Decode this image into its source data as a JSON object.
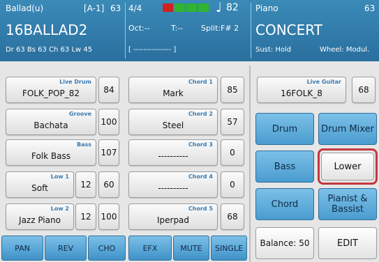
{
  "header": {
    "style": {
      "name": "Ballad(u)",
      "slot": "[A-1]",
      "value": "63",
      "big": "16BALLAD2",
      "info": "Dr 63   Bs 63   Ch 63   Lw 45"
    },
    "center": {
      "time_sig": "4/4",
      "tempo": "82",
      "tempo_icon": "quarter-note-icon",
      "oct": "Oct:--",
      "t": "T:--",
      "split": "Split:F# 2",
      "bar": "[ --------------- ]"
    },
    "voice": {
      "name": "Piano",
      "value": "63",
      "big": "CONCERT",
      "sust": "Sust: Hold",
      "wheel": "Wheel: Modul."
    },
    "colors": {
      "beat_lights": [
        "#d02020",
        "#2fb52f",
        "#2fb52f",
        "#2fb52f"
      ]
    }
  },
  "left_pads": [
    {
      "tag": "Live Drum",
      "label": "FOLK_POP_82",
      "value": "84"
    },
    {
      "tag": "Groove",
      "label": "Bachata",
      "value": "100"
    },
    {
      "tag": "Bass",
      "label": "Folk Bass",
      "value": "107"
    },
    {
      "tag": "Low 1",
      "label": "Soft",
      "aux": "12",
      "value": "60"
    },
    {
      "tag": "Low 2",
      "label": "Jazz Piano",
      "aux": "12",
      "value": "100"
    }
  ],
  "chord_pads": [
    {
      "tag": "Chord 1",
      "label": "Mark",
      "value": "85"
    },
    {
      "tag": "Chord 2",
      "label": "Steel",
      "value": "57"
    },
    {
      "tag": "Chord 3",
      "label": "----------",
      "value": "0"
    },
    {
      "tag": "Chord 4",
      "label": "----------",
      "value": "0"
    },
    {
      "tag": "Chord 5",
      "label": "Iperpad",
      "value": "68"
    }
  ],
  "guitar_pad": {
    "tag": "Live Guitar",
    "label": "16FOLK_8",
    "value": "68"
  },
  "bottom_buttons": [
    "PAN",
    "REV",
    "CHO",
    "EFX",
    "MUTE",
    "SINGLE"
  ],
  "right_buttons": {
    "drum": "Drum",
    "drum_mixer": "Drum Mixer",
    "bass": "Bass",
    "lower": "Lower",
    "chord": "Chord",
    "pianist_bassist": "Pianist & Bassist",
    "balance": "Balance: 50",
    "edit": "EDIT"
  },
  "colors": {
    "header": "#2f7aab",
    "highlight": "#c2373f",
    "tag": "#3a7bb0"
  }
}
